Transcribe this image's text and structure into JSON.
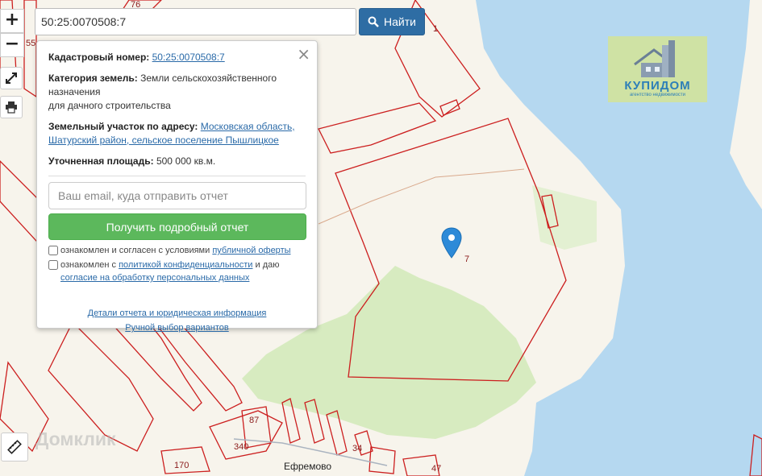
{
  "controls": {
    "zoom_in_label": "+",
    "zoom_out_label": "−"
  },
  "search": {
    "value": "50:25:0070508:7",
    "button_label": "Найти"
  },
  "popup": {
    "cadastral_label": "Кадастровый номер:",
    "cadastral_value": "50:25:0070508:7",
    "category_label": "Категория земель:",
    "category_value_line1": "Земли сельскохозяйственного",
    "category_value_line2": "назначения",
    "category_value_line3": "для дачного строительства",
    "address_label": "Земельный участок по адресу:",
    "address_value_line1": "Московская область,",
    "address_value_line2": "Шатурский район, сельское поселение Пышлицкое",
    "area_label": "Уточненная площадь:",
    "area_value": "500 000 кв.м.",
    "email_placeholder": "Ваш email, куда отправить отчет",
    "report_button": "Получить подробный отчет",
    "consent1_text": "ознакомлен и согласен с условиями",
    "consent1_link": "публичной оферты",
    "consent2_text_a": "ознакомлен с",
    "consent2_link_a": "политикой конфиденциальности",
    "consent2_text_b": "и даю",
    "consent2_link_b": "согласие на обработку персональных данных",
    "details_link": "Детали отчета и юридическая информация",
    "manual_link": "Ручной выбор вариантов",
    "close_label": "×"
  },
  "logo": {
    "brand": "КУПИДОМ",
    "subtitle": "агентство недвижимости"
  },
  "watermark": "Домклик",
  "map_labels": {
    "l76": "76",
    "l1": "1",
    "l7": "7",
    "l55": "55",
    "l87": "87",
    "l340": "340",
    "l170": "170",
    "l34": "34",
    "l47": "47",
    "village": "Ефремово"
  },
  "colors": {
    "water": "#b5d8f0",
    "land": "#f7f4ec",
    "green": "#d7ebc0",
    "parcel_border": "#cc1f1f",
    "search_button": "#2e6da4",
    "report_button": "#5cb85c"
  }
}
